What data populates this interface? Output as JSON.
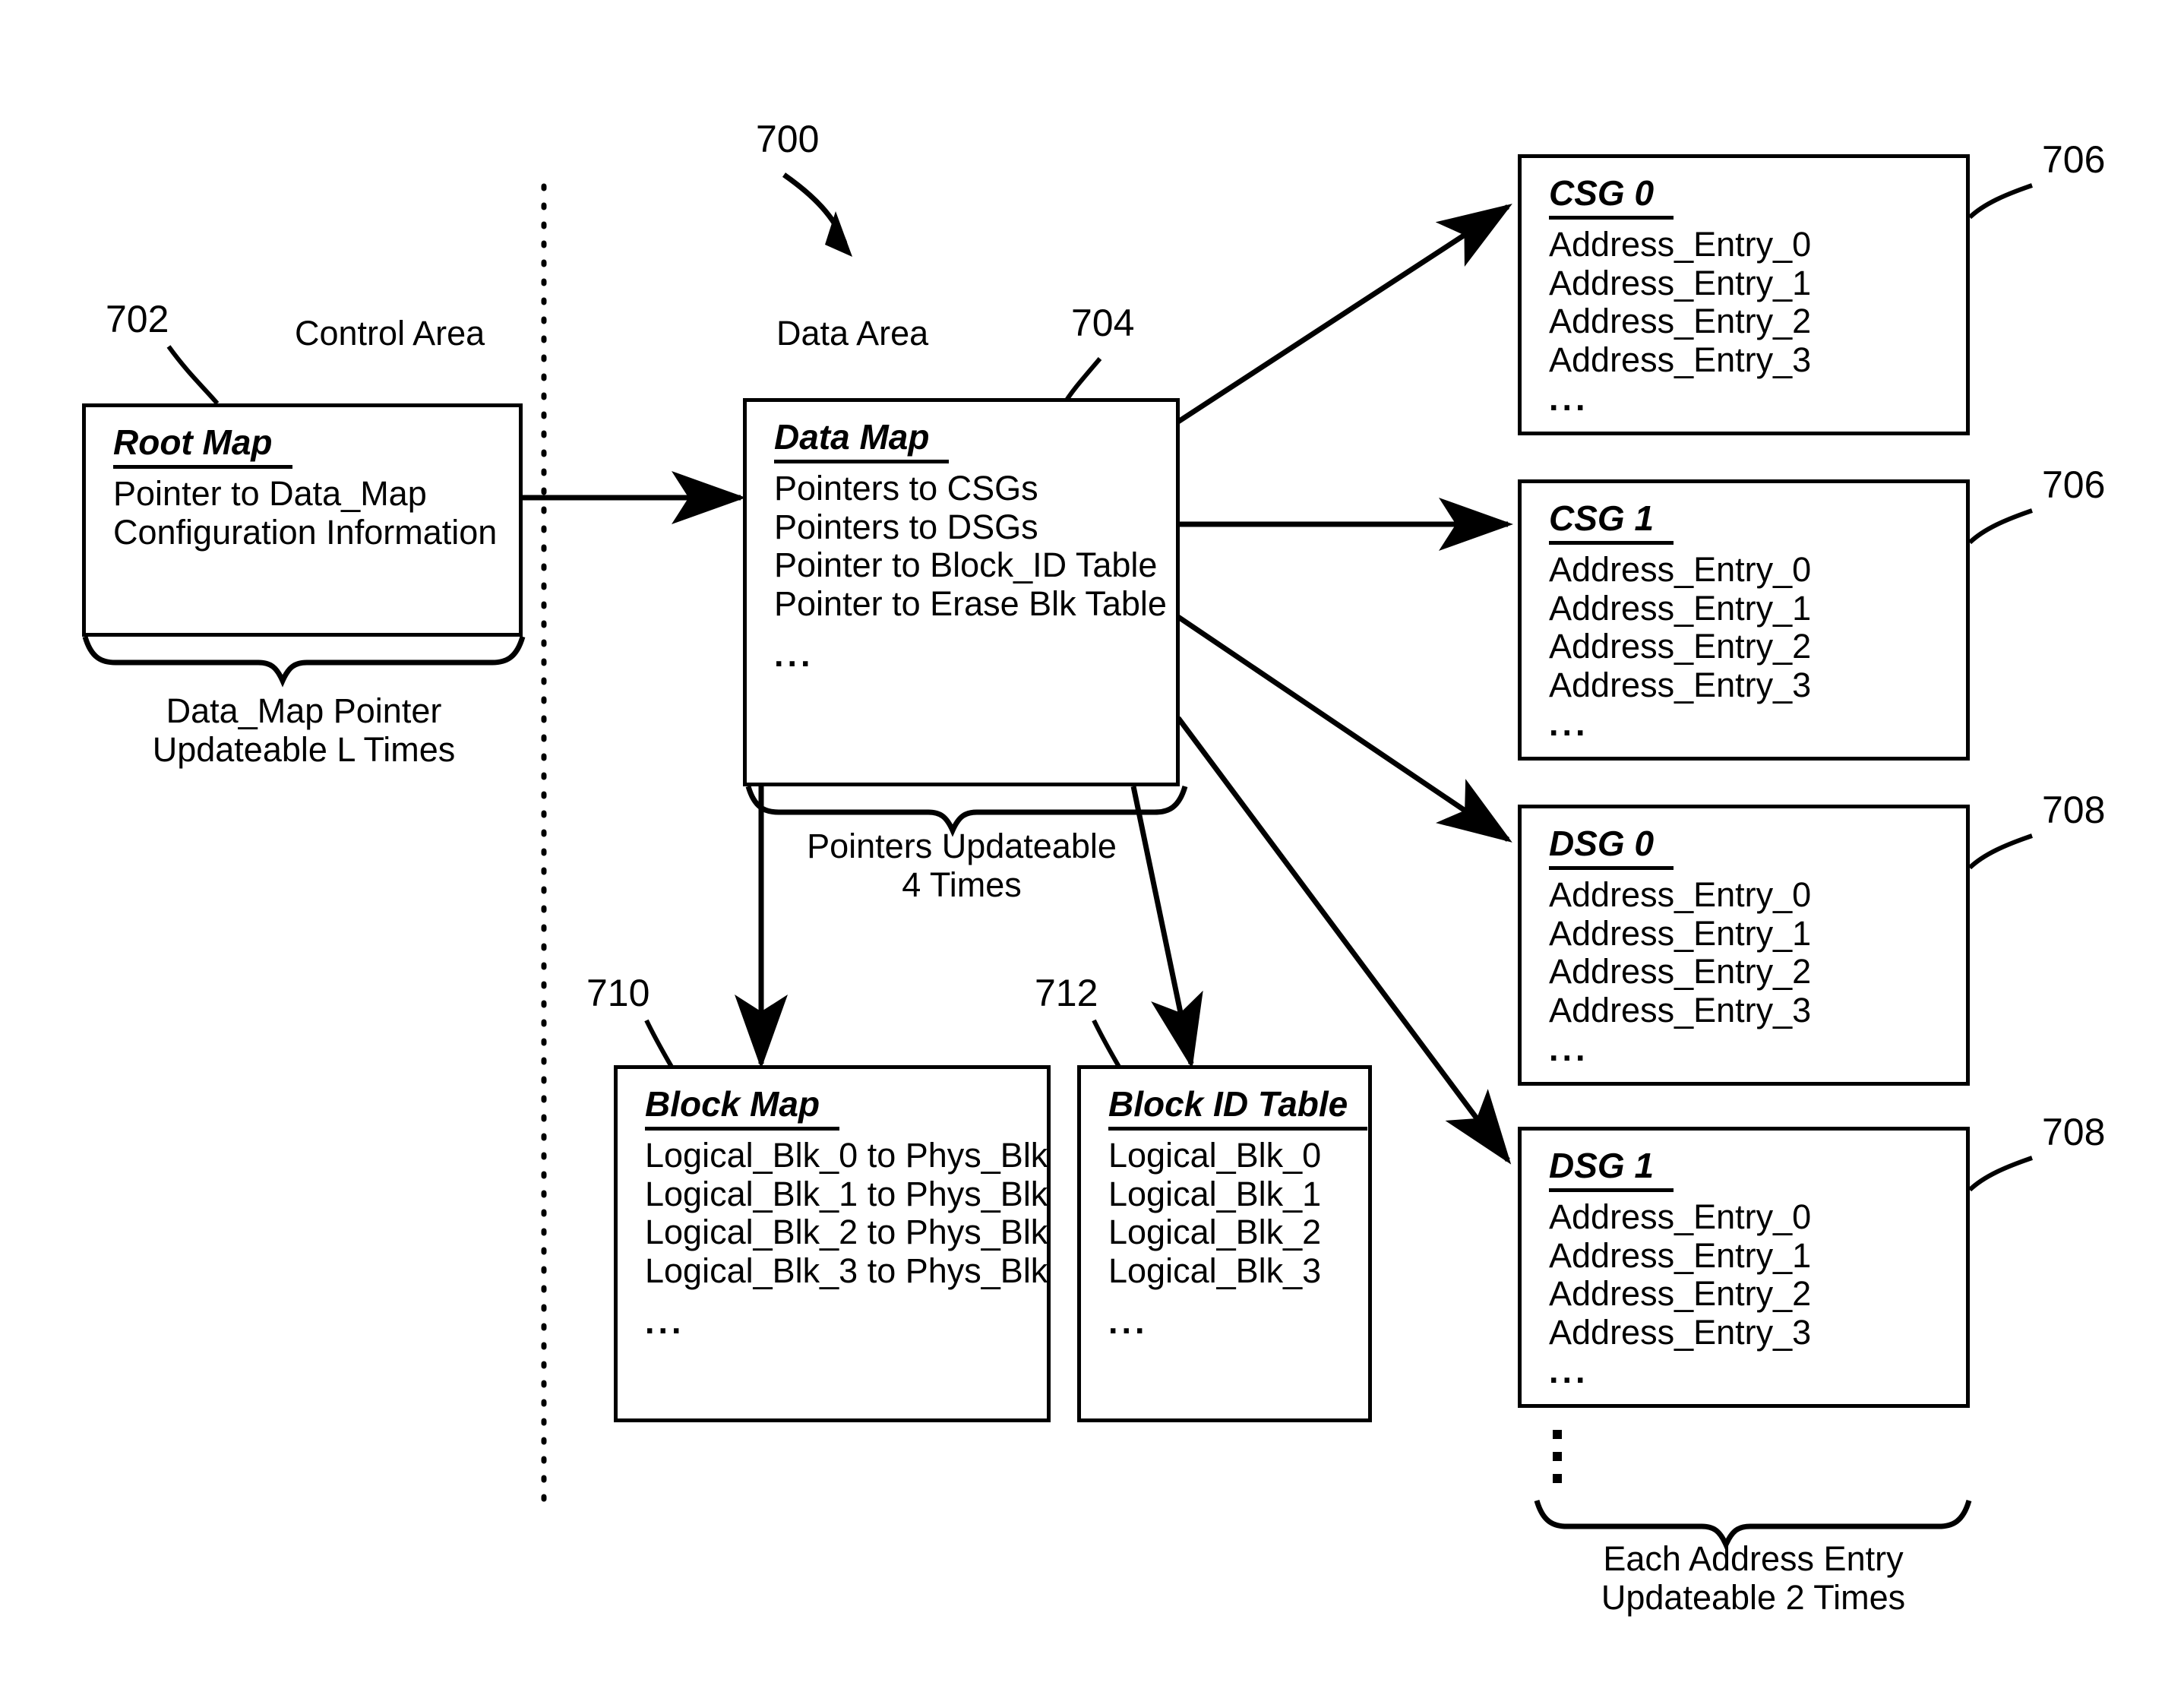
{
  "figure": {
    "number": "700",
    "divider": "dotted-vertical-divider"
  },
  "areas": {
    "control": "Control Area",
    "data": "Data Area"
  },
  "refs": {
    "root_map": "702",
    "data_map": "704",
    "csg0": "706",
    "csg1": "706",
    "dsg0": "708",
    "dsg1": "708",
    "block_map": "710",
    "block_id_table": "712"
  },
  "boxes": {
    "root_map": {
      "title": "Root Map",
      "lines": [
        "Pointer to Data_Map",
        "Configuration Information"
      ],
      "ellipsis": ""
    },
    "data_map": {
      "title": "Data Map",
      "lines": [
        "Pointers to CSGs",
        "Pointers to DSGs",
        "Pointer to Block_ID Table",
        "Pointer to Erase Blk Table"
      ],
      "ellipsis": "..."
    },
    "csg0": {
      "title": "CSG 0",
      "lines": [
        "Address_Entry_0",
        "Address_Entry_1",
        "Address_Entry_2",
        "Address_Entry_3"
      ],
      "ellipsis": "..."
    },
    "csg1": {
      "title": "CSG 1",
      "lines": [
        "Address_Entry_0",
        "Address_Entry_1",
        "Address_Entry_2",
        "Address_Entry_3"
      ],
      "ellipsis": "..."
    },
    "dsg0": {
      "title": "DSG 0",
      "lines": [
        "Address_Entry_0",
        "Address_Entry_1",
        "Address_Entry_2",
        "Address_Entry_3"
      ],
      "ellipsis": "..."
    },
    "dsg1": {
      "title": "DSG 1",
      "lines": [
        "Address_Entry_0",
        "Address_Entry_1",
        "Address_Entry_2",
        "Address_Entry_3"
      ],
      "ellipsis": "..."
    },
    "block_map": {
      "title": "Block Map",
      "lines": [
        "Logical_Blk_0 to Phys_Blk",
        "Logical_Blk_1 to Phys_Blk",
        "Logical_Blk_2 to Phys_Blk",
        "Logical_Blk_3 to Phys_Blk"
      ],
      "ellipsis": "..."
    },
    "block_id_table": {
      "title": "Block ID Table",
      "lines": [
        "Logical_Blk_0",
        "Logical_Blk_1",
        "Logical_Blk_2",
        "Logical_Blk_3"
      ],
      "ellipsis": "..."
    }
  },
  "captions": {
    "root_brace_line1": "Data_Map Pointer",
    "root_brace_line2": "Updateable L Times",
    "data_brace_line1": "Pointers Updateable",
    "data_brace_line2": "4 Times",
    "entries_brace_line1": "Each Address Entry",
    "entries_brace_line2": "Updateable 2 Times"
  }
}
